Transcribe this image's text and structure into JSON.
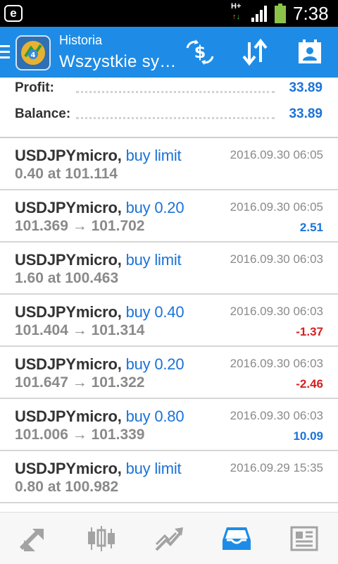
{
  "status_bar": {
    "notification_badge": "e",
    "network_type": "H+",
    "time": "7:38"
  },
  "app_bar": {
    "subtitle": "Historia",
    "title": "Wszystkie sy…",
    "color": "#1e8ce6"
  },
  "summary": {
    "profit_label": "Profit:",
    "profit_value": "33.89",
    "balance_label": "Balance:",
    "balance_value": "33.89"
  },
  "trades": [
    {
      "symbol": "USDJPYmicro,",
      "action": "buy limit",
      "detail": "0.40 at 101.114",
      "datetime": "2016.09.30 06:05",
      "profit": "",
      "profit_sign": "none"
    },
    {
      "symbol": "USDJPYmicro,",
      "action": "buy 0.20",
      "detail": "101.369 → 101.702",
      "datetime": "2016.09.30 06:05",
      "profit": "2.51",
      "profit_sign": "positive"
    },
    {
      "symbol": "USDJPYmicro,",
      "action": "buy limit",
      "detail": "1.60 at 100.463",
      "datetime": "2016.09.30 06:03",
      "profit": "",
      "profit_sign": "none"
    },
    {
      "symbol": "USDJPYmicro,",
      "action": "buy 0.40",
      "detail": "101.404 → 101.314",
      "datetime": "2016.09.30 06:03",
      "profit": "-1.37",
      "profit_sign": "negative"
    },
    {
      "symbol": "USDJPYmicro,",
      "action": "buy 0.20",
      "detail": "101.647 → 101.322",
      "datetime": "2016.09.30 06:03",
      "profit": "-2.46",
      "profit_sign": "negative"
    },
    {
      "symbol": "USDJPYmicro,",
      "action": "buy 0.80",
      "detail": "101.006 → 101.339",
      "datetime": "2016.09.30 06:03",
      "profit": "10.09",
      "profit_sign": "positive"
    },
    {
      "symbol": "USDJPYmicro,",
      "action": "buy limit",
      "detail": "0.80 at 100.982",
      "datetime": "2016.09.29 15:35",
      "profit": "",
      "profit_sign": "none"
    }
  ],
  "bottom_nav": {
    "items": [
      "quotes-icon",
      "chart-icon",
      "trade-icon",
      "history-icon",
      "news-icon"
    ],
    "active": "history-icon",
    "active_color": "#1e8ce6",
    "inactive_color": "#9e9e9e"
  },
  "colors": {
    "accent": "#1a73d9",
    "negative": "#d62020"
  }
}
